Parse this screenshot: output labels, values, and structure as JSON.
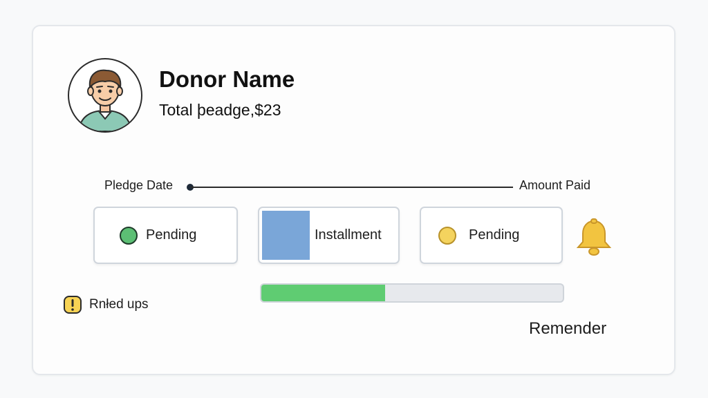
{
  "donor": {
    "name": "Donor Name",
    "pledge_total": "Total þeadge,$23"
  },
  "timeline": {
    "start_label": "Pledge Date",
    "end_label": "Amount Paid"
  },
  "status_cards": [
    {
      "label": "Pending",
      "icon": "green-status-dot-icon"
    },
    {
      "label": "Installment",
      "icon": "installment-block"
    },
    {
      "label": "Pending",
      "icon": "yellow-status-dot-icon"
    }
  ],
  "followups": {
    "label": "Rnłed ups",
    "icon": "exclamation-badge-icon"
  },
  "progress": {
    "value": 0.41
  },
  "reminder": {
    "label": "Remender",
    "icon": "bell-icon"
  },
  "colors": {
    "progress_fill": "#5fcc72",
    "installment_block": "#7aa6d8",
    "pending_green": "#5cbf74",
    "pending_yellow": "#f4d35e",
    "bell": "#f2c440"
  }
}
